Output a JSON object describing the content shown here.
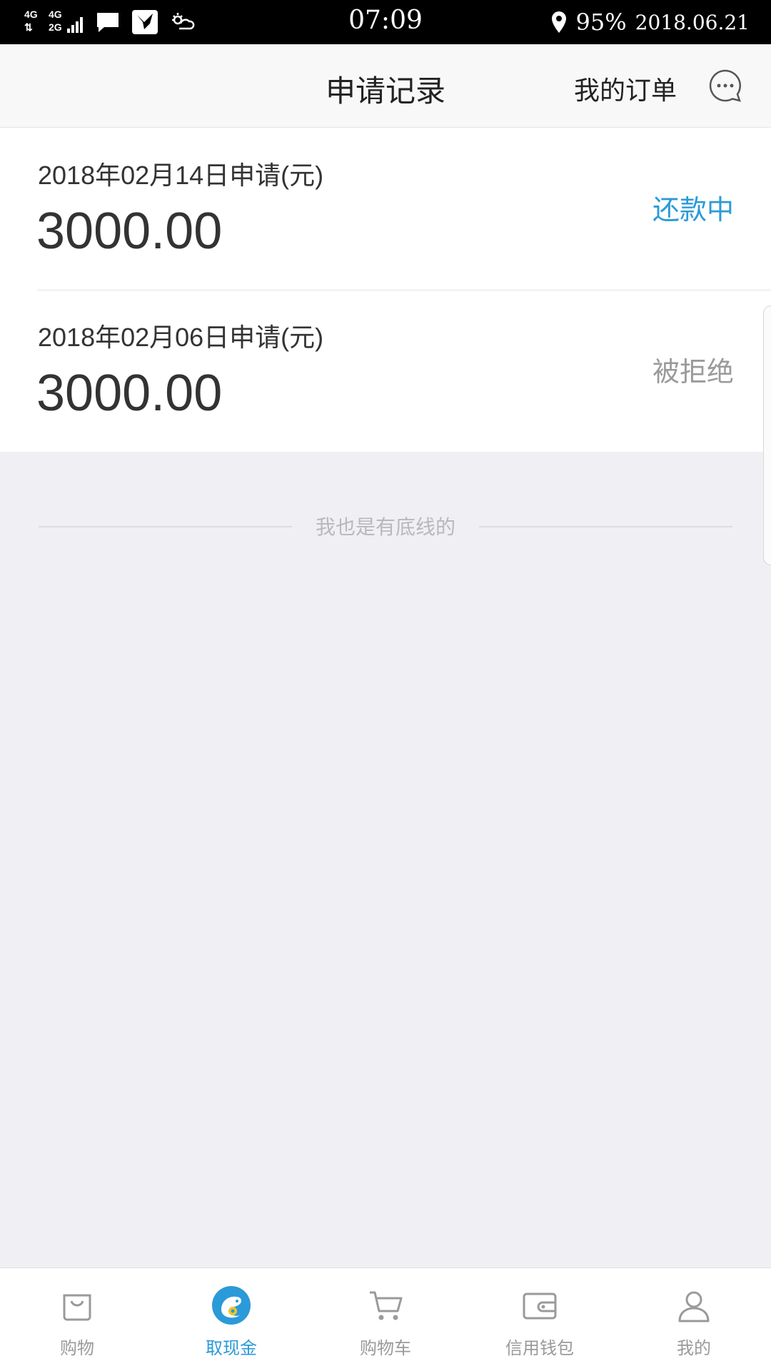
{
  "status_bar": {
    "network_1": "4G",
    "network_2": "4G",
    "network_3": "2G",
    "time": "07:09",
    "battery": "95%",
    "date": "2018.06.21"
  },
  "header": {
    "title": "申请记录",
    "orders_link": "我的订单"
  },
  "records": [
    {
      "date_label": "2018年02月14日申请(元)",
      "amount": "3000.00",
      "status": "还款中"
    },
    {
      "date_label": "2018年02月06日申请(元)",
      "amount": "3000.00",
      "status": "被拒绝"
    }
  ],
  "end_message": "我也是有底线的",
  "tabbar": {
    "tabs": [
      {
        "label": "购物",
        "icon": "shopping-bag-icon"
      },
      {
        "label": "取现金",
        "icon": "cash-icon"
      },
      {
        "label": "购物车",
        "icon": "cart-icon"
      },
      {
        "label": "信用钱包",
        "icon": "wallet-icon"
      },
      {
        "label": "我的",
        "icon": "user-icon"
      }
    ],
    "active_index": 1
  },
  "colors": {
    "accent": "#2b9ad8",
    "status_active": "#2b9ad8",
    "status_rejected": "#9a9a9a",
    "background": "#efeff4"
  }
}
